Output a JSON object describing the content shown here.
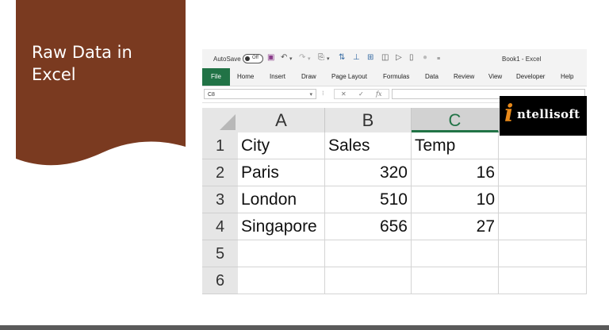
{
  "slide": {
    "title_line1": "Raw Data in",
    "title_line2": "Excel"
  },
  "qat": {
    "autosave_label": "AutoSave",
    "autosave_state": "Off",
    "document_title": "Book1 - Excel",
    "icons": [
      "save-icon",
      "undo-icon",
      "redo-icon",
      "format-painter-icon",
      "sort-icon",
      "filter-icon",
      "pivot-icon",
      "camera-icon",
      "print-preview-icon",
      "new-doc-icon",
      "record-icon",
      "customize-icon"
    ]
  },
  "ribbon": {
    "tabs": [
      "File",
      "Home",
      "Insert",
      "Draw",
      "Page Layout",
      "Formulas",
      "Data",
      "Review",
      "View",
      "Developer",
      "Help"
    ]
  },
  "formula_bar": {
    "name_box_value": "C8",
    "formula_value": ""
  },
  "sheet": {
    "columns": [
      "A",
      "B",
      "C"
    ],
    "selected_column": "C",
    "rows": [
      "1",
      "2",
      "3",
      "4",
      "5",
      "6"
    ],
    "cells": [
      [
        "City",
        "Sales",
        "Temp"
      ],
      [
        "Paris",
        "320",
        "16"
      ],
      [
        "London",
        "510",
        "10"
      ],
      [
        "Singapore",
        "656",
        "27"
      ],
      [
        "",
        "",
        ""
      ],
      [
        "",
        "",
        ""
      ]
    ]
  },
  "logo": {
    "letter": "i",
    "text": "ntellisoft"
  },
  "colors": {
    "title_card": "#7a3a20",
    "excel_green": "#217346",
    "logo_orange": "#e98a1a"
  }
}
